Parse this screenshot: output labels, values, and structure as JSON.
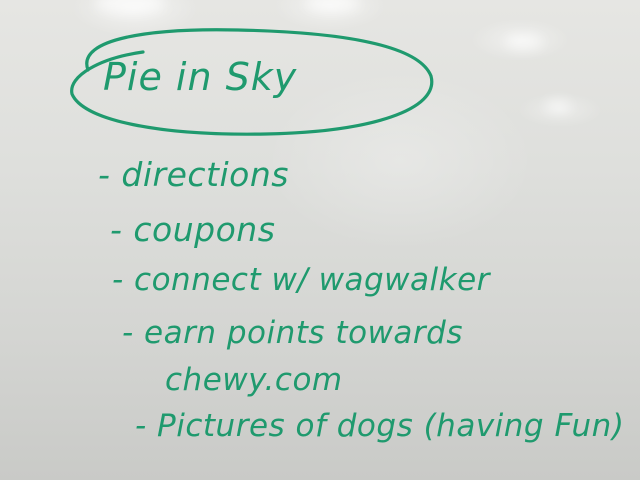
{
  "board": {
    "title": "Pie in Sky",
    "items": [
      "- directions",
      "- coupons",
      "- connect w/ wagwalker",
      "- earn points towards",
      "chewy.com",
      "- Pictures of dogs (having Fun)"
    ]
  },
  "colors": {
    "marker_ink": "#1f9a6e",
    "whiteboard": "#dedfdc"
  }
}
